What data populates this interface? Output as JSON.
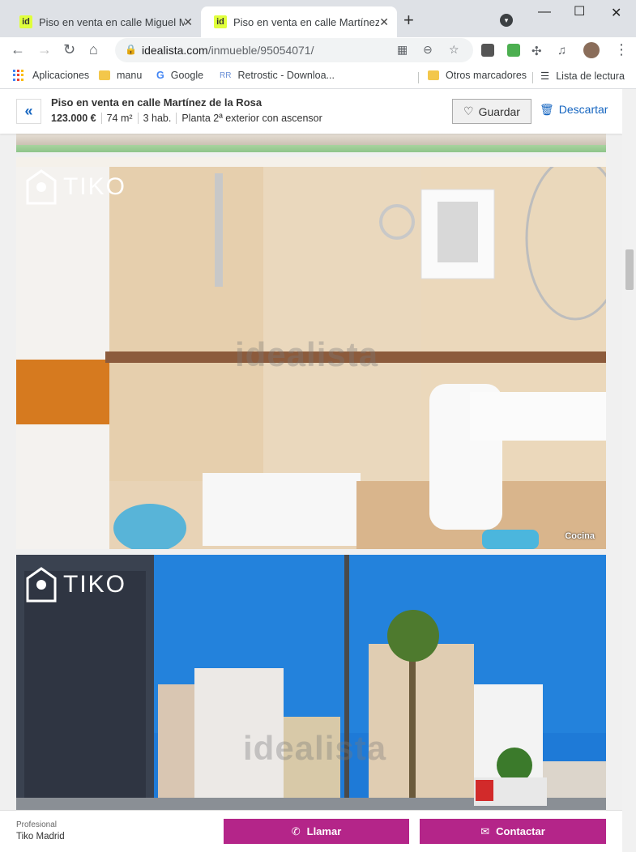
{
  "browser": {
    "tabs": [
      {
        "label": "Piso en venta en calle Miguel Mo",
        "favicon": "id",
        "active": false
      },
      {
        "label": "Piso en venta en calle Martínez de",
        "favicon": "id",
        "active": true
      }
    ],
    "url_domain": "idealista.com",
    "url_path": "/inmueble/95054071/",
    "bookmarks": [
      "Aplicaciones",
      "manu",
      "Google",
      "Retrostic - Downloa...",
      "Otros marcadores",
      "Lista de lectura"
    ]
  },
  "listing": {
    "title": "Piso en venta en calle Martínez de la Rosa",
    "price": "123.000 €",
    "area": "74 m²",
    "rooms": "3 hab.",
    "floor": "Planta 2ª exterior con ascensor",
    "save_label": "Guardar",
    "discard_label": "Descartar"
  },
  "photos": [
    {
      "label": ""
    },
    {
      "label": "Cocina",
      "brand": "TIKO",
      "watermark": "idealista"
    },
    {
      "label": "",
      "brand": "TIKO",
      "watermark": "idealista"
    }
  ],
  "footer": {
    "type": "Profesional",
    "agency": "Tiko Madrid",
    "call_label": "Llamar",
    "contact_label": "Contactar"
  },
  "colors": {
    "accent": "#b42589",
    "link": "#1565c0"
  }
}
